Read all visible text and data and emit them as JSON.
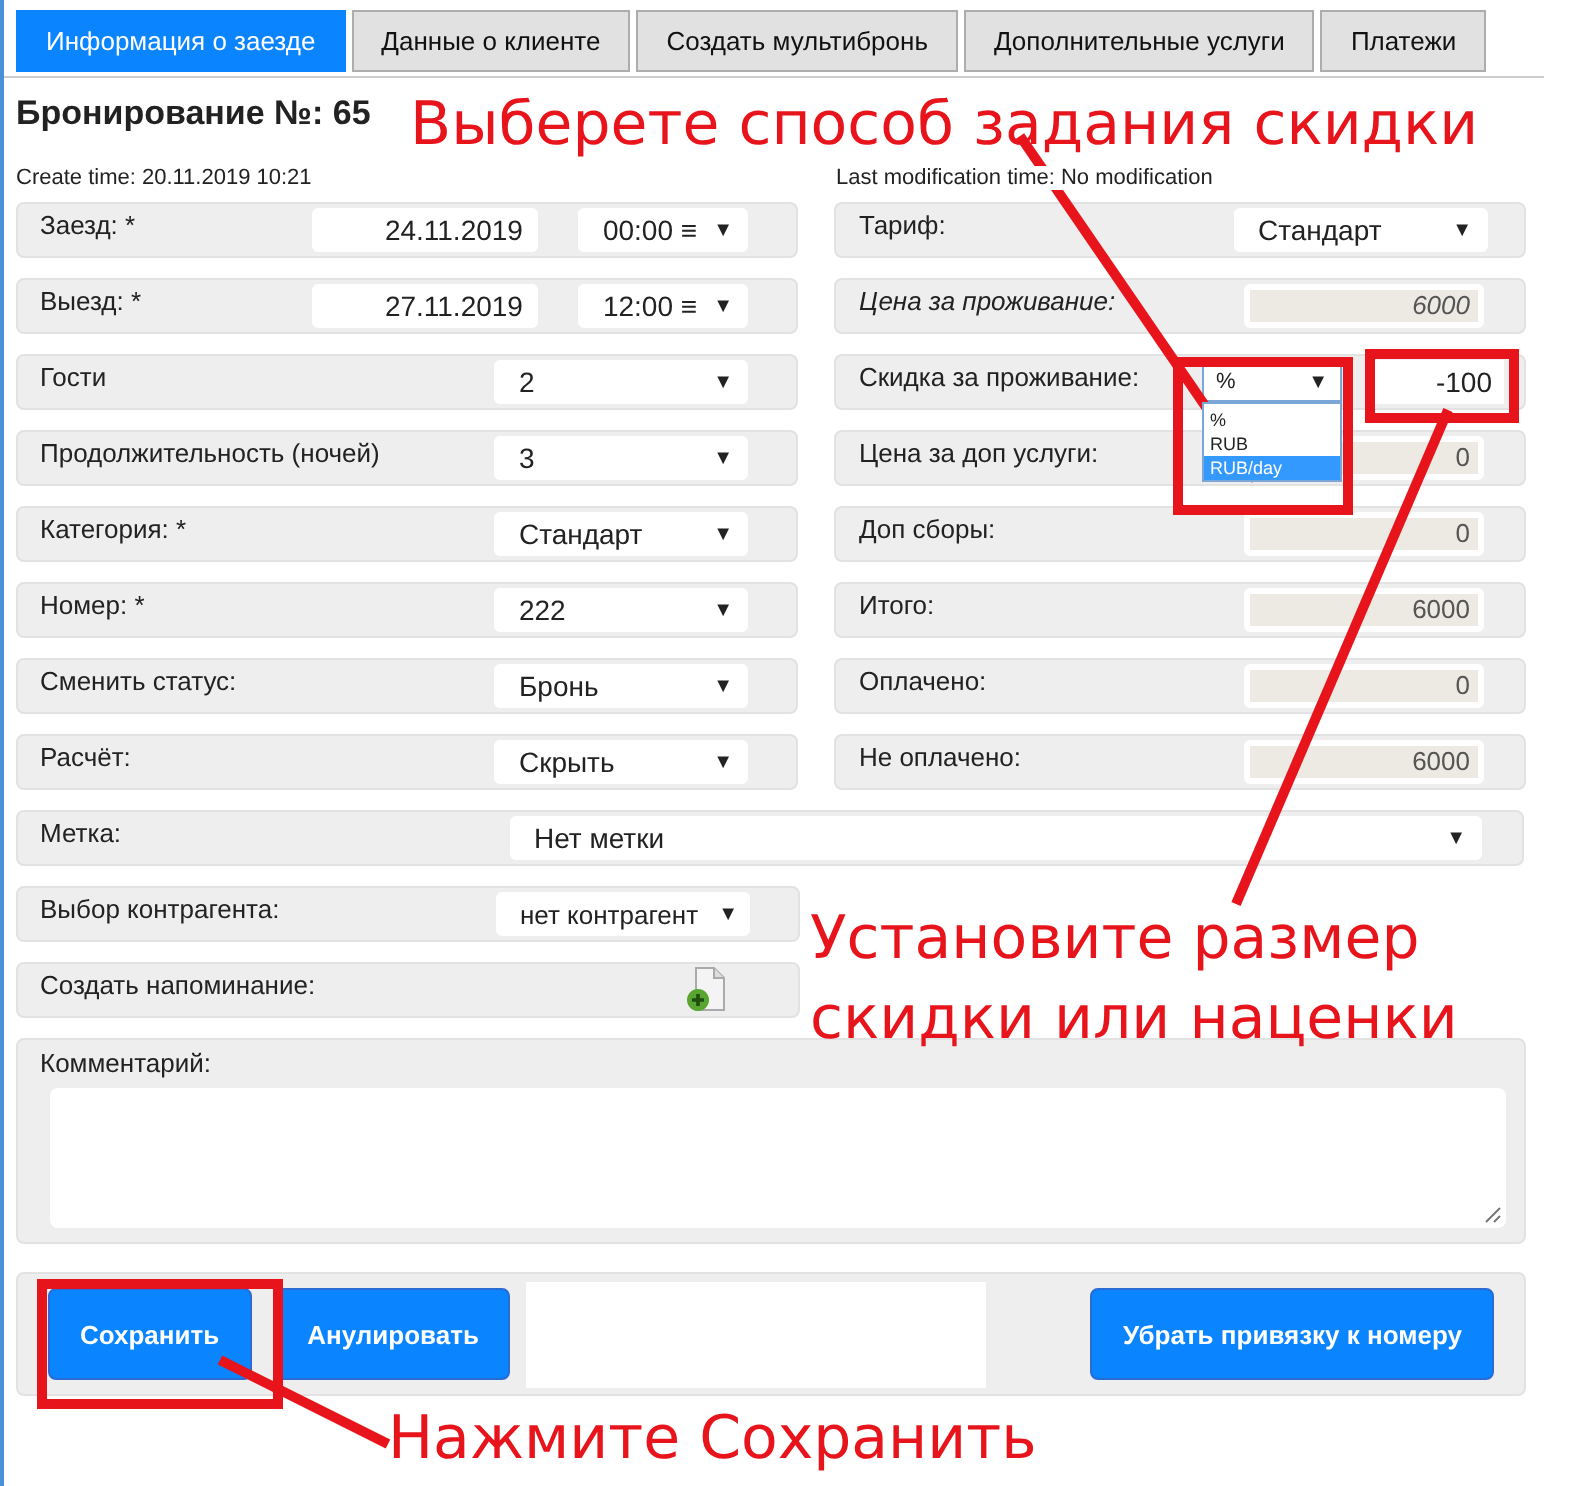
{
  "tabs": [
    {
      "label": "Информация о заезде",
      "selected": true
    },
    {
      "label": "Данные о клиенте",
      "selected": false
    },
    {
      "label": "Создать мультибронь",
      "selected": false
    },
    {
      "label": "Дополнительные услуги",
      "selected": false
    },
    {
      "label": "Платежи",
      "selected": false
    }
  ],
  "title": "Бронирование №: 65",
  "create_time": "Create time: 20.11.2019 10:21",
  "last_modification": "Last modification time: No modification",
  "left_fields": [
    {
      "kind": "date",
      "label": "Заезд: *",
      "value": "24.11.2019",
      "time": "00:00 ≡",
      "caret": "▼"
    },
    {
      "kind": "date",
      "label": "Выезд: *",
      "value": "27.11.2019",
      "time": "12:00 ≡",
      "caret": "▼"
    },
    {
      "kind": "select",
      "label": "Гости",
      "value": "2",
      "caret": "▼"
    },
    {
      "kind": "select",
      "label": "Продолжительность (ночей)",
      "value": "3",
      "caret": "▼"
    },
    {
      "kind": "select",
      "label": "Категория: *",
      "value": "Стандарт",
      "caret": "▼"
    },
    {
      "kind": "select",
      "label": "Номер: *",
      "value": "222",
      "caret": "▼"
    },
    {
      "kind": "select",
      "label": "Сменить статус:",
      "value": "Бронь",
      "caret": "▼"
    },
    {
      "kind": "select",
      "label": "Расчёт:",
      "value": "Скрыть",
      "caret": "▼"
    }
  ],
  "right_fields": [
    {
      "kind": "select",
      "label": "Тариф:",
      "value": "Стандарт",
      "caret": "▼"
    },
    {
      "kind": "computed",
      "label": "Цена за проживание:",
      "value": "6000"
    },
    {
      "kind": "discount",
      "label": "Скидка за проживание:",
      "unit": "%",
      "caret": "▼",
      "value": "-100",
      "options": [
        {
          "label": "%",
          "selected": false
        },
        {
          "label": "RUB",
          "selected": false
        },
        {
          "label": "RUB/day",
          "selected": true
        }
      ]
    },
    {
      "kind": "readonly",
      "label": "Цена за доп услуги:",
      "value": "0"
    },
    {
      "kind": "readonly",
      "label": "Доп сборы:",
      "value": "0"
    },
    {
      "kind": "readonly",
      "label": "Итого:",
      "value": "6000"
    },
    {
      "kind": "readonly",
      "label": "Оплачено:",
      "value": "0"
    },
    {
      "kind": "readonly",
      "label": "Не оплачено:",
      "value": "6000"
    }
  ],
  "tag": {
    "label": "Метка:",
    "value": "Нет метки",
    "caret": "▼"
  },
  "counterparty": {
    "label": "Выбор контрагента:",
    "value": "нет контрагент",
    "caret": "▼"
  },
  "reminder": {
    "label": "Создать напоминание:"
  },
  "comment": {
    "label": "Комментарий:"
  },
  "buttons_left": [
    "Сохранить",
    "Анулировать"
  ],
  "buttons_right": [
    "Убрать привязку к номеру"
  ],
  "annotations": [
    "Выберете способ задания скидки",
    "Установите размер скидки или наценки",
    "Нажмите Сохранить"
  ]
}
